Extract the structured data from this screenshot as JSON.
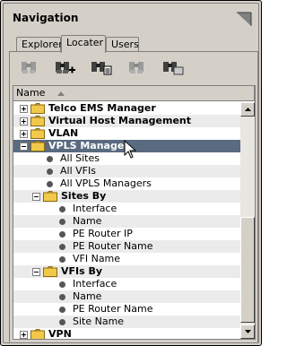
{
  "panel": {
    "title": "Navigation",
    "tabs": [
      {
        "label": "Explorer",
        "active": false
      },
      {
        "label": "Locater",
        "active": true
      },
      {
        "label": "Users",
        "active": false
      }
    ]
  },
  "toolbar": {
    "buttons": [
      {
        "name": "find-icon",
        "enabled": false
      },
      {
        "name": "find-add-icon",
        "enabled": true
      },
      {
        "name": "find-list-icon",
        "enabled": true
      },
      {
        "name": "find-next-icon",
        "enabled": false
      },
      {
        "name": "find-folder-icon",
        "enabled": true
      }
    ]
  },
  "list": {
    "column_header": "Name",
    "sort": "ascending",
    "rows": [
      {
        "label": "Telco EMS Manager",
        "indent": 0,
        "type": "folder",
        "expander": "plus",
        "bold": true
      },
      {
        "label": "Virtual Host Management",
        "indent": 0,
        "type": "folder",
        "expander": "plus",
        "bold": true
      },
      {
        "label": "VLAN",
        "indent": 0,
        "type": "folder",
        "expander": "plus",
        "bold": true
      },
      {
        "label": "VPLS Manager",
        "indent": 0,
        "type": "folder",
        "expander": "minus",
        "bold": true,
        "selected": true
      },
      {
        "label": "All Sites",
        "indent": 1,
        "type": "leaf"
      },
      {
        "label": "All VFIs",
        "indent": 1,
        "type": "leaf"
      },
      {
        "label": "All VPLS Managers",
        "indent": 1,
        "type": "leaf"
      },
      {
        "label": "Sites By",
        "indent": 1,
        "type": "folder",
        "expander": "minus",
        "bold": true
      },
      {
        "label": "Interface",
        "indent": 2,
        "type": "leaf"
      },
      {
        "label": "Name",
        "indent": 2,
        "type": "leaf"
      },
      {
        "label": "PE Router IP",
        "indent": 2,
        "type": "leaf"
      },
      {
        "label": "PE Router Name",
        "indent": 2,
        "type": "leaf"
      },
      {
        "label": "VFI Name",
        "indent": 2,
        "type": "leaf"
      },
      {
        "label": "VFIs By",
        "indent": 1,
        "type": "folder",
        "expander": "minus",
        "bold": true
      },
      {
        "label": "Interface",
        "indent": 2,
        "type": "leaf"
      },
      {
        "label": "Name",
        "indent": 2,
        "type": "leaf"
      },
      {
        "label": "PE Router Name",
        "indent": 2,
        "type": "leaf"
      },
      {
        "label": "Site Name",
        "indent": 2,
        "type": "leaf"
      },
      {
        "label": "VPN",
        "indent": 0,
        "type": "folder",
        "expander": "plus",
        "bold": true
      }
    ]
  },
  "colors": {
    "selection": "#5a6b80",
    "folder": "#f2c84b",
    "panel_bg": "#d4d0c8"
  }
}
